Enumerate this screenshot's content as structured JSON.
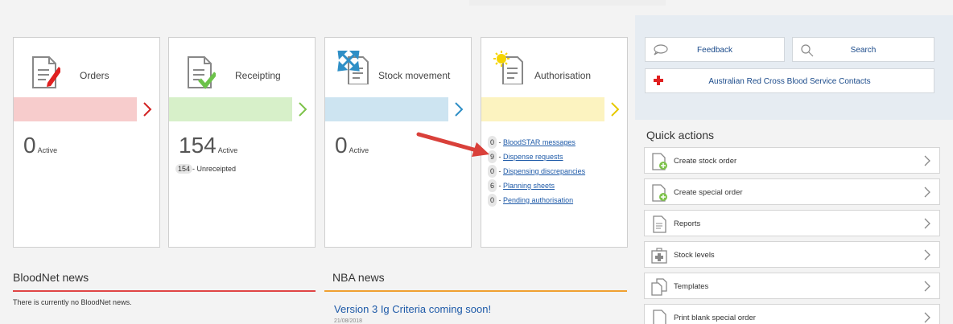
{
  "tiles": [
    {
      "title": "Orders",
      "count": "0",
      "count_label": "Active",
      "bar_color": "#f7cccc",
      "arrow_color": "#d22222"
    },
    {
      "title": "Receipting",
      "count": "154",
      "count_label": "Active",
      "bar_color": "#d7f0c9",
      "arrow_color": "#7dc24a",
      "sub_count": "154",
      "sub_label": "- Unreceipted"
    },
    {
      "title": "Stock movement",
      "count": "0",
      "count_label": "Active",
      "bar_color": "#cde4f1",
      "arrow_color": "#2f8fc6"
    },
    {
      "title": "Authorisation",
      "bar_color": "#fcf3c0",
      "arrow_color": "#e6c800",
      "items": [
        {
          "count": "0",
          "label": "BloodSTAR messages"
        },
        {
          "count": "9",
          "label": "Dispense requests"
        },
        {
          "count": "0",
          "label": "Dispensing discrepancies"
        },
        {
          "count": "6",
          "label": "Planning sheets"
        },
        {
          "count": "0",
          "label": "Pending authorisation"
        }
      ]
    }
  ],
  "news": {
    "bloodnet": {
      "title": "BloodNet news",
      "text": "There is currently no BloodNet news.",
      "rule_color": "#e04545"
    },
    "nba": {
      "title": "NBA news",
      "headline": "Version 3 Ig Criteria coming soon!",
      "date": "21/08/2018",
      "rule_color": "#f0a030"
    }
  },
  "right": {
    "feedback_label": "Feedback",
    "search_label": "Search",
    "contacts_label": "Australian Red Cross Blood Service Contacts"
  },
  "quick_actions": {
    "title": "Quick actions",
    "items": [
      {
        "label": "Create stock order",
        "icon": "add-document-icon"
      },
      {
        "label": "Create special order",
        "icon": "add-document-icon"
      },
      {
        "label": "Reports",
        "icon": "document-icon"
      },
      {
        "label": "Stock levels",
        "icon": "medical-kit-icon"
      },
      {
        "label": "Templates",
        "icon": "copy-documents-icon"
      },
      {
        "label": "Print blank special order",
        "icon": "blank-document-icon"
      }
    ]
  }
}
